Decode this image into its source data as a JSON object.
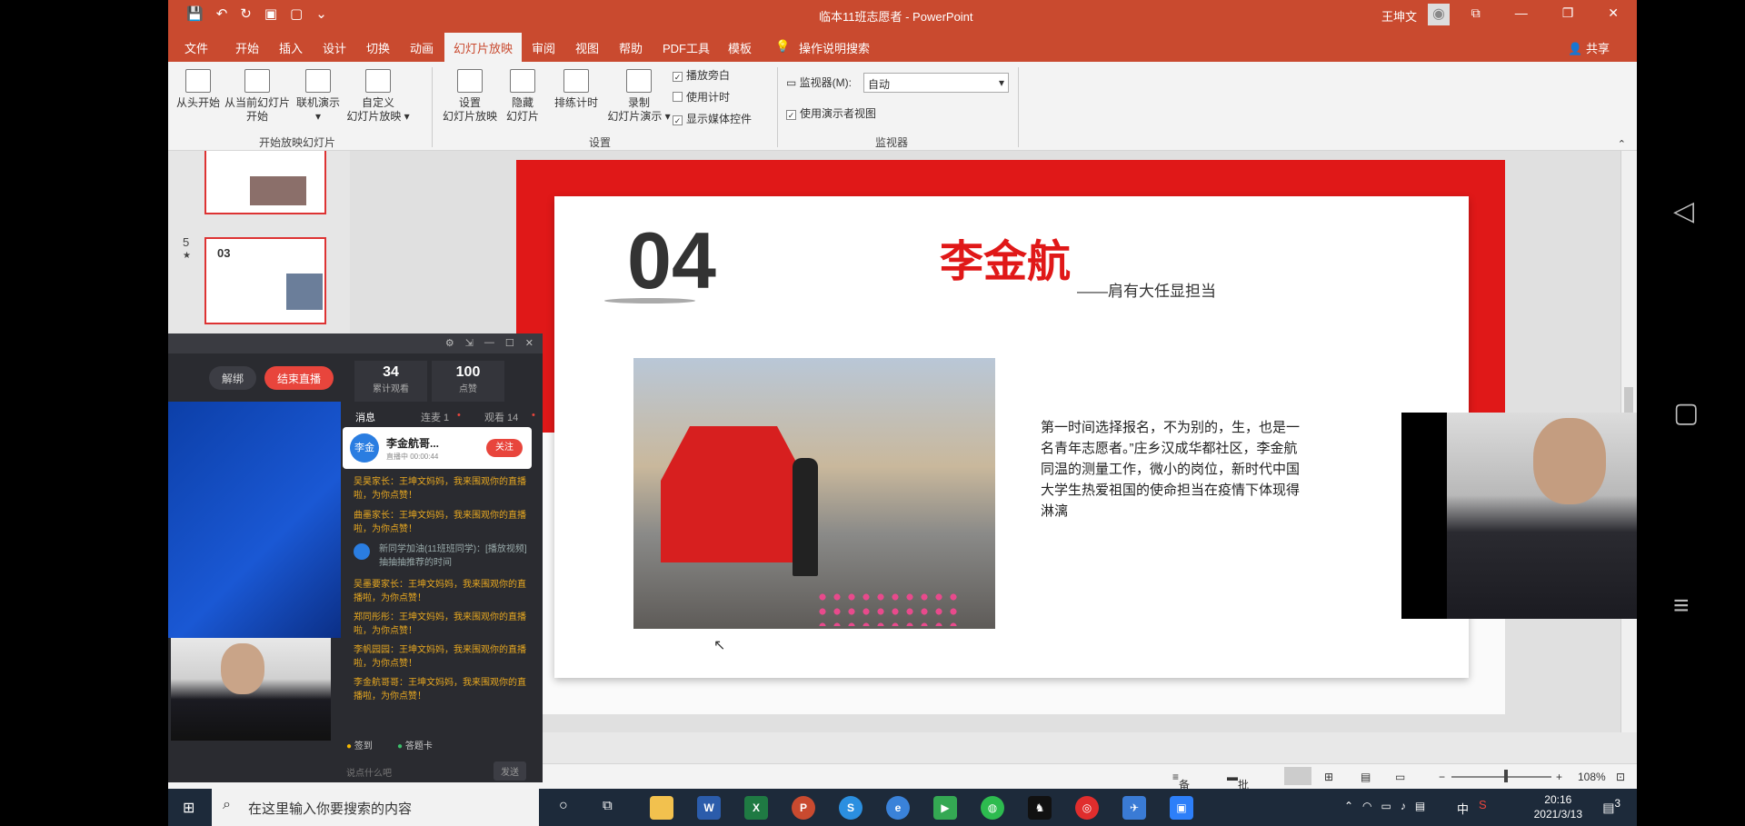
{
  "window": {
    "title": "临本11班志愿者 - PowerPoint",
    "user": "王坤文",
    "quick_access": [
      "💾",
      "↶",
      "↻",
      "▣",
      "▢",
      "⌄"
    ],
    "controls": [
      "⧉",
      "—",
      "❐",
      "✕"
    ]
  },
  "tabs": [
    {
      "label": "文件"
    },
    {
      "label": "开始"
    },
    {
      "label": "插入"
    },
    {
      "label": "设计"
    },
    {
      "label": "切换"
    },
    {
      "label": "动画"
    },
    {
      "label": "幻灯片放映",
      "active": true
    },
    {
      "label": "审阅"
    },
    {
      "label": "视图"
    },
    {
      "label": "帮助"
    },
    {
      "label": "PDF工具"
    },
    {
      "label": "模板"
    },
    {
      "label": "操作说明搜索"
    }
  ],
  "share_label": "共享",
  "ribbon": {
    "start": [
      {
        "label1": "从头开始",
        "label2": ""
      },
      {
        "label1": "从当前幻灯片",
        "label2": "开始"
      },
      {
        "label1": "联机演示",
        "label2": "▾"
      },
      {
        "label1": "自定义",
        "label2": "幻灯片放映 ▾"
      }
    ],
    "start_group": "开始放映幻灯片",
    "setup": [
      {
        "label1": "设置",
        "label2": "幻灯片放映"
      },
      {
        "label1": "隐藏",
        "label2": "幻灯片"
      },
      {
        "label1": "排练计时",
        "label2": ""
      },
      {
        "label1": "录制",
        "label2": "幻灯片演示 ▾"
      }
    ],
    "checks": [
      {
        "label": "播放旁白",
        "checked": true
      },
      {
        "label": "使用计时",
        "checked": false
      },
      {
        "label": "显示媒体控件",
        "checked": true
      }
    ],
    "setup_group": "设置",
    "monitor_label": "监视器(M):",
    "monitor_value": "自动",
    "presenter_view": "使用演示者视图",
    "monitor_group": "监视器"
  },
  "thumbs": {
    "slide_number": "5",
    "star": "★",
    "thumb_title": "03"
  },
  "slide": {
    "number": "04",
    "name": "李金航",
    "subtitle": "——肩有大任显担当",
    "body": "第一时间选择报名，不为别的，生，也是一名青年志愿者。”庄乡汉成华都社区，李金航同温的测量工作，微小的岗位，新时代中国大学生热爱祖国的使命担当在疫情下体现得淋漓"
  },
  "status": {
    "notes": "备注",
    "comments": "批注",
    "zoom": "108%",
    "minus": "−",
    "plus": "+"
  },
  "live": {
    "mute": "解绑",
    "end": "结束直播",
    "stats": [
      {
        "n": "34",
        "l": "累计观看"
      },
      {
        "n": "100",
        "l": "点赞"
      }
    ],
    "tabs": [
      "消息",
      "连麦 1",
      "观看 14"
    ],
    "card_name": "李金航哥...",
    "card_sub": "直播中 00:00:44",
    "card_btn": "关注",
    "card_avatar": "李金",
    "messages": [
      "吴昊家长：王坤文妈妈，我来围观你的直播啦，为你点赞！",
      "曲墨家长：王坤文妈妈，我来围观你的直播啦，为你点赞！",
      "吴墨要家长：王坤文妈妈，我来围观你的直播啦，为你点赞！",
      "郑同彤彤：王坤文妈妈，我来围观你的直播啦，为你点赞！",
      "李帆园园：王坤文妈妈，我来围观你的直播啦，为你点赞！",
      "李金航哥哥：王坤文妈妈，我来围观你的直播啦，为你点赞！"
    ],
    "gray_message": "新同学加油(11班班同学)：[播放视频]抽抽抽推荐的时间",
    "bottom_left": "签到",
    "bottom_right": "答题卡",
    "input_placeholder": "说点什么吧",
    "send": "发送"
  },
  "taskbar": {
    "search_placeholder": "在这里输入你要搜索的内容",
    "time": "20:16",
    "date": "2021/3/13",
    "lang": "中",
    "notif": "3"
  }
}
